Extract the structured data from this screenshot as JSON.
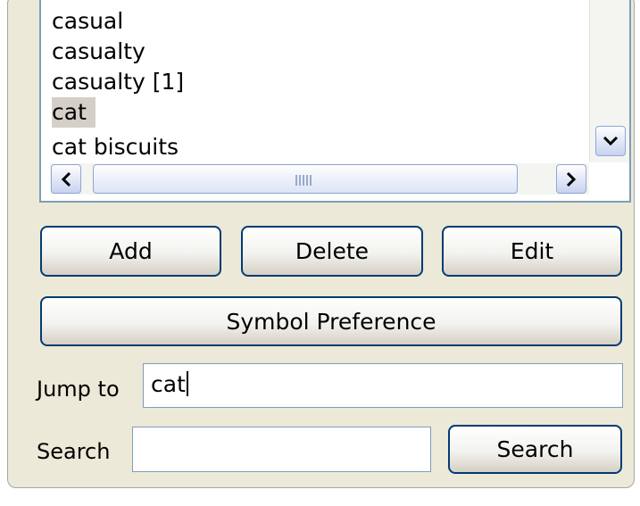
{
  "list": {
    "items": [
      "casual",
      "casualty",
      "casualty [1]",
      "cat",
      "cat biscuits"
    ],
    "selected_index": 3
  },
  "scrollbar": {
    "down_icon": "chevron-down-icon",
    "left_icon": "chevron-left-icon",
    "right_icon": "chevron-right-icon",
    "down_glyph": "⌄",
    "left_glyph": "<",
    "right_glyph": ">"
  },
  "buttons": {
    "add_label": "Add",
    "delete_label": "Delete",
    "edit_label": "Edit",
    "symbol_pref_label": "Symbol Preference",
    "search_label": "Search"
  },
  "jump": {
    "label": "Jump to",
    "value": "cat"
  },
  "search": {
    "label": "Search",
    "value": ""
  },
  "colors": {
    "panel_bg": "#ece9d8",
    "button_border": "#003c74",
    "field_border": "#7f9db9",
    "selection_bg": "#d4d0c8"
  }
}
